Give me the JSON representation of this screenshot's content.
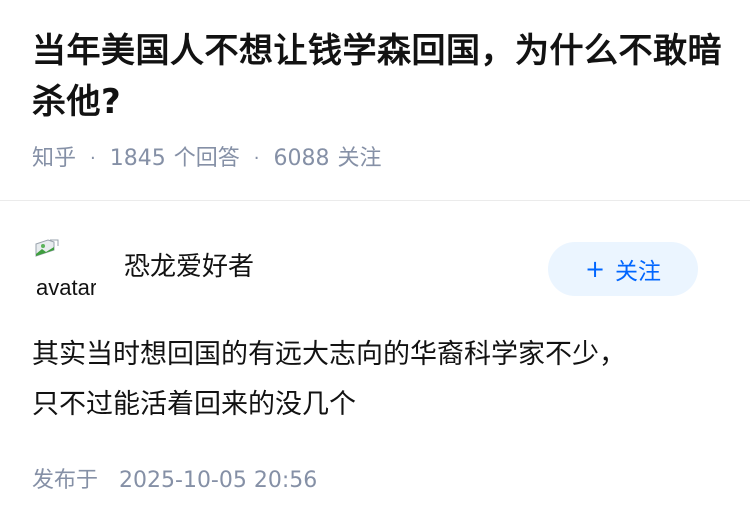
{
  "question": {
    "title": "当年美国人不想让钱学森回国，为什么不敢暗杀他?",
    "source": "知乎",
    "answer_count": "1845",
    "answer_label": "个回答",
    "follow_count": "6088",
    "follow_label": "关注"
  },
  "author": {
    "avatar_alt": "avatar",
    "name": "恐龙爱好者",
    "follow_button_label": "关注",
    "follow_button_icon": "plus-icon"
  },
  "answer": {
    "lines": [
      "其实当时想回国的有远大志向的华裔科学家不少，",
      "只不过能活着回来的没几个"
    ],
    "published_label": "发布于",
    "published_time": "2025-10-05 20:56"
  },
  "colors": {
    "title": "#121212",
    "meta": "#8590a6",
    "follow_button_bg": "#ebf5ff",
    "follow_button_text": "#0066ff",
    "divider": "#ebebeb"
  }
}
